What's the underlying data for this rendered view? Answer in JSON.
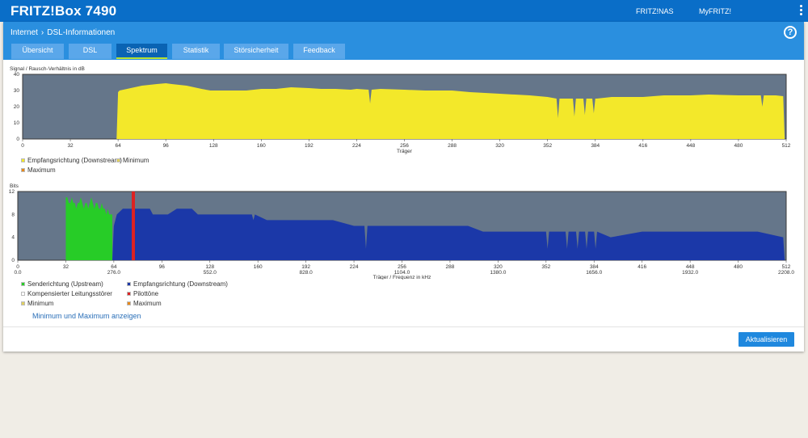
{
  "header": {
    "brand": "FRITZ!Box 7490",
    "links": [
      "FRITZ!NAS",
      "MyFRITZ!"
    ]
  },
  "breadcrumb": {
    "section": "Internet",
    "page": "DSL-Informationen",
    "separator": "›"
  },
  "help_label": "?",
  "tabs": [
    {
      "label": "Übersicht",
      "active": false
    },
    {
      "label": "DSL",
      "active": false
    },
    {
      "label": "Spektrum",
      "active": true
    },
    {
      "label": "Statistik",
      "active": false
    },
    {
      "label": "Störsicherheit",
      "active": false
    },
    {
      "label": "Feedback",
      "active": false
    }
  ],
  "snr_chart": {
    "title": "Signal / Rausch-Verhältnis in dB",
    "xlabel": "Träger",
    "legend": [
      {
        "label": "Empfangsrichtung (Downstream)",
        "color": "#f3e82a"
      },
      {
        "label": "Minimum",
        "color": "#e0d060"
      },
      {
        "label": "Maximum",
        "color": "#e88818"
      }
    ]
  },
  "bits_chart": {
    "title": "Bits",
    "xlabel": "Träger / Frequenz in kHz",
    "legend": [
      {
        "label": "Senderichtung (Upstream)",
        "color": "#27cc27"
      },
      {
        "label": "Empfangsrichtung (Downstream)",
        "color": "#1b38a8"
      },
      {
        "label": "Kompensierter Leitungsstörer",
        "color": "#ffffff"
      },
      {
        "label": "Pilottöne",
        "color": "#dd2222"
      },
      {
        "label": "Minimum",
        "color": "#e0d060"
      },
      {
        "label": "Maximum",
        "color": "#e88818"
      }
    ]
  },
  "show_minmax_link": "Minimum und Maximum anzeigen",
  "refresh_button": "Aktualisieren",
  "colors": {
    "topbar": "#0a6ec8",
    "panel_head": "#2a8fdf",
    "plot_bg": "#65768a",
    "snr": "#f3e82a",
    "upstream": "#27cc27",
    "downstream": "#1b38a8",
    "pilot": "#dd2222"
  },
  "chart_data": [
    {
      "type": "area",
      "title": "Signal / Rausch-Verhältnis in dB",
      "xlabel": "Träger",
      "xlim": [
        0,
        512
      ],
      "ylim": [
        0,
        40
      ],
      "x_ticks": [
        0,
        32,
        64,
        96,
        128,
        160,
        192,
        224,
        256,
        288,
        320,
        352,
        384,
        416,
        448,
        480,
        512
      ],
      "y_ticks": [
        0,
        10,
        20,
        30,
        40
      ],
      "series": [
        {
          "name": "Empfangsrichtung (Downstream)",
          "color": "#f3e82a",
          "x": [
            0,
            63,
            64,
            65,
            70,
            75,
            80,
            85,
            90,
            96,
            100,
            105,
            110,
            115,
            120,
            126,
            130,
            140,
            150,
            160,
            170,
            180,
            192,
            200,
            210,
            220,
            224,
            232,
            233,
            234,
            240,
            256,
            270,
            288,
            300,
            320,
            340,
            352,
            358,
            359,
            360,
            365,
            369,
            370,
            371,
            376,
            377,
            378,
            382,
            383,
            384,
            385,
            395,
            416,
            430,
            448,
            460,
            480,
            495,
            496,
            497,
            505,
            510,
            511,
            512
          ],
          "y": [
            0,
            0,
            29,
            30,
            31,
            32,
            33,
            33.5,
            34,
            34.5,
            34,
            33.5,
            33,
            32,
            31,
            30,
            30,
            30,
            30,
            31,
            31,
            32,
            31.5,
            31,
            31,
            30.5,
            31,
            30.5,
            22,
            30.5,
            31,
            30.5,
            30,
            30,
            29,
            28,
            27,
            26,
            25,
            13,
            25,
            25,
            25,
            14,
            25,
            25,
            15,
            25,
            25,
            16,
            25,
            25,
            26,
            26,
            27,
            27,
            27.5,
            27,
            27,
            20,
            27,
            27,
            26.5,
            0,
            0
          ]
        }
      ]
    },
    {
      "type": "area",
      "title": "Bits",
      "xlabel": "Träger / Frequenz in kHz",
      "xlim": [
        0,
        512
      ],
      "ylim": [
        0,
        12
      ],
      "x_ticks": [
        0,
        32,
        64,
        96,
        128,
        160,
        192,
        224,
        256,
        288,
        320,
        352,
        384,
        416,
        448,
        480,
        512
      ],
      "x_freq_labels": [
        "0.0",
        "276.0",
        "552.0",
        "828.0",
        "1104.0",
        "1380.0",
        "1656.0",
        "1932.0",
        "2208.0"
      ],
      "y_ticks": [
        0,
        4,
        8,
        12
      ],
      "series": [
        {
          "name": "Senderichtung (Upstream)",
          "color": "#27cc27",
          "x": [
            32,
            33,
            34,
            35,
            36,
            37,
            38,
            39,
            40,
            41,
            42,
            43,
            44,
            45,
            46,
            47,
            48,
            49,
            50,
            51,
            52,
            53,
            54,
            55,
            56,
            57,
            58,
            59,
            60,
            61,
            62,
            63
          ],
          "y": [
            11,
            11,
            10,
            10,
            11,
            10,
            10,
            9,
            10,
            10,
            11,
            10,
            9,
            10,
            10,
            9,
            10,
            11,
            10,
            9,
            10,
            10,
            9,
            9,
            10,
            9,
            9,
            8,
            9,
            8,
            8,
            8
          ]
        },
        {
          "name": "Empfangsrichtung (Downstream)",
          "color": "#1b38a8",
          "x": [
            63,
            64,
            66,
            70,
            80,
            88,
            90,
            96,
            100,
            106,
            110,
            116,
            120,
            127,
            130,
            140,
            150,
            156,
            157,
            158,
            166,
            170,
            180,
            190,
            200,
            210,
            224,
            231,
            232,
            233,
            240,
            256,
            288,
            300,
            310,
            320,
            350,
            352,
            353,
            354,
            360,
            365,
            366,
            367,
            372,
            373,
            374,
            378,
            379,
            380,
            384,
            385,
            386,
            395,
            416,
            448,
            480,
            493,
            510,
            511
          ],
          "y": [
            0,
            6,
            8,
            9,
            9,
            9,
            8,
            8,
            8,
            9,
            9,
            9,
            8,
            8,
            8,
            8,
            8,
            8,
            7,
            8,
            7,
            7,
            7,
            7,
            7,
            7,
            6,
            6,
            2,
            6,
            6,
            6,
            6,
            6,
            5,
            5,
            5,
            5,
            2,
            5,
            5,
            5,
            2,
            5,
            5,
            2,
            5,
            5,
            2,
            5,
            5,
            2,
            5,
            4,
            5,
            5,
            5,
            5,
            4,
            0
          ]
        },
        {
          "name": "Pilottöne",
          "color": "#dd2222",
          "x": [
            77
          ],
          "y": [
            12
          ]
        }
      ]
    }
  ]
}
